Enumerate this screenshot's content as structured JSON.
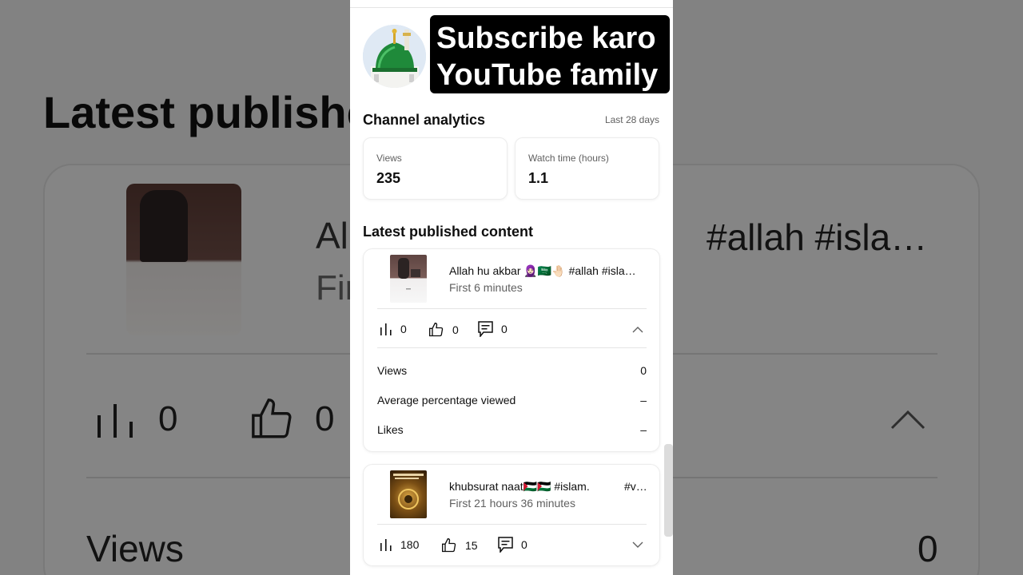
{
  "background": {
    "heading": "Latest publishe",
    "video_title_left": "All",
    "video_title_right": "#allah #isla…",
    "video_sub": "Fir",
    "likes": "0",
    "views_stat": "0",
    "views_label": "Views",
    "views_value": "0"
  },
  "banner": {
    "line1": "Subscribe karo",
    "line2": "YouTube family"
  },
  "analytics": {
    "title": "Channel analytics",
    "range": "Last 28 days",
    "views_label": "Views",
    "views_value": "235",
    "watch_label": "Watch time (hours)",
    "watch_value": "1.1"
  },
  "latest": {
    "title": "Latest published content",
    "videos": [
      {
        "title": "Allah hu akbar 🧕🏻🇸🇦🤚🏻 #allah #isla…",
        "subtitle": "First 6 minutes",
        "views": "0",
        "likes": "0",
        "comments": "0",
        "expanded": true,
        "details": [
          {
            "label": "Views",
            "value": "0"
          },
          {
            "label": "Average percentage viewed",
            "value": "–"
          },
          {
            "label": "Likes",
            "value": "–"
          }
        ]
      },
      {
        "title": "khubsurat naat🇵🇸🇵🇸 #islam.",
        "title_end": "#v…",
        "subtitle": "First 21 hours 36 minutes",
        "views": "180",
        "likes": "15",
        "comments": "0",
        "expanded": false
      }
    ]
  },
  "icons": [
    "views-bars-icon",
    "thumbs-up-icon",
    "comment-icon",
    "chevron-up-icon",
    "chevron-down-icon"
  ]
}
